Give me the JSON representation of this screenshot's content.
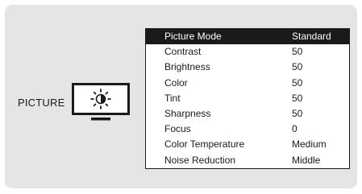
{
  "section": {
    "label": "PICTURE",
    "icon": "tv-brightness-icon"
  },
  "menu": {
    "selected_index": 0,
    "items": [
      {
        "label": "Picture Mode",
        "value": "Standard"
      },
      {
        "label": "Contrast",
        "value": "50"
      },
      {
        "label": "Brightness",
        "value": "50"
      },
      {
        "label": "Color",
        "value": "50"
      },
      {
        "label": "Tint",
        "value": "50"
      },
      {
        "label": "Sharpness",
        "value": "50"
      },
      {
        "label": "Focus",
        "value": "0"
      },
      {
        "label": "Color Temperature",
        "value": "Medium"
      },
      {
        "label": "Noise Reduction",
        "value": "Middle"
      }
    ]
  },
  "colors": {
    "panel_bg": "#e5e5e5",
    "selected_bg": "#1a1a1a",
    "text": "#1a1a1a"
  }
}
